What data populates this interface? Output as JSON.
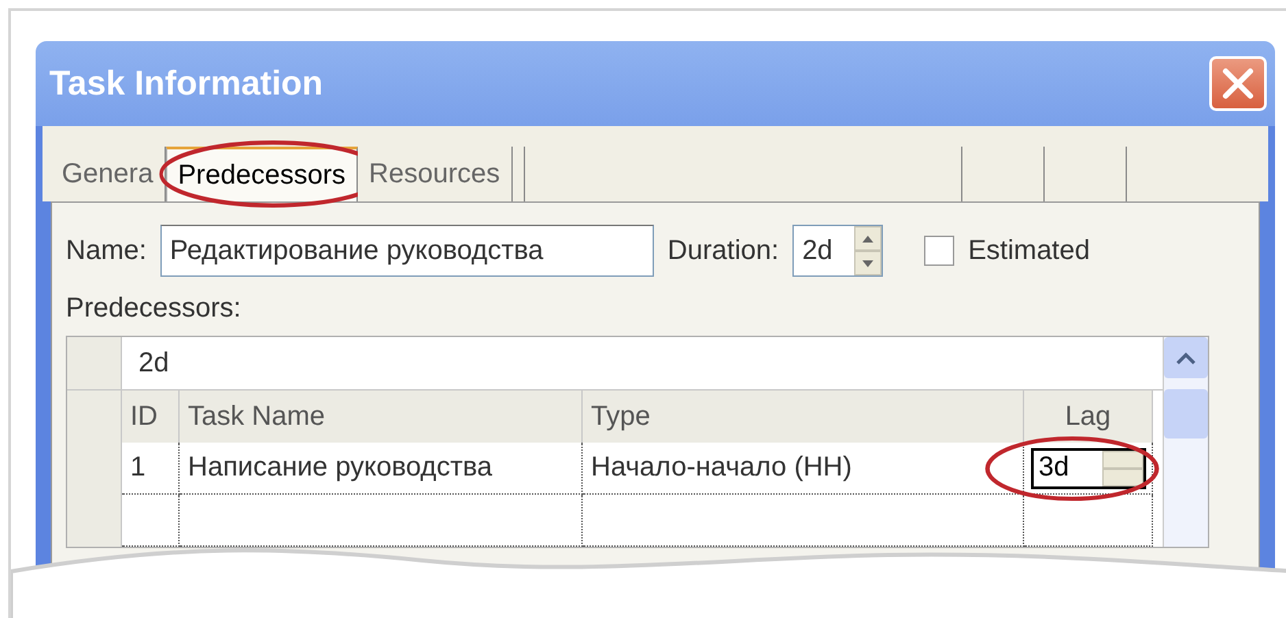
{
  "window": {
    "title": "Task Information"
  },
  "tabs": [
    {
      "label": "Genera",
      "selected": false,
      "annotated": false
    },
    {
      "label": "Predecessors",
      "selected": true,
      "annotated": true
    },
    {
      "label": "Resources",
      "selected": false,
      "annotated": false
    }
  ],
  "form": {
    "name_label": "Name:",
    "name_value": "Редактирование руководства",
    "duration_label": "Duration:",
    "duration_value": "2d",
    "estimated": {
      "label": "Estimated",
      "checked": false
    },
    "predecessors_label": "Predecessors:"
  },
  "grid": {
    "edit_value": "2d",
    "columns": [
      "ID",
      "Task Name",
      "Type",
      "Lag"
    ],
    "rows": [
      {
        "id": "1",
        "task_name": "Написание руководства",
        "type": "Начало-начало (НН)",
        "lag": "3d",
        "annotated": true
      }
    ]
  }
}
